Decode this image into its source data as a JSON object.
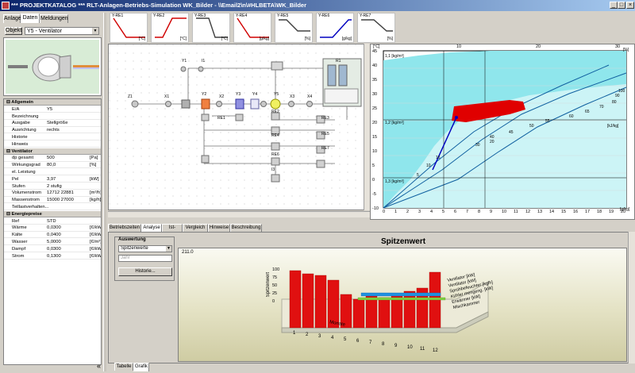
{
  "window": {
    "title": "*** PROJEKTKATALOG *** RLT-Anlagen-Betriebs-Simulation WK_Bilder - \\\\Email2\\n\\#HLBETA\\WK_Bilder"
  },
  "left_tabs": [
    "Anlage",
    "Daten",
    "Meldungen"
  ],
  "objekt_button": "Objekt",
  "objekt_select": "Y5 - Ventilator",
  "mini_charts": [
    {
      "label": "Y-RE1",
      "unit": "[°C]"
    },
    {
      "label": "Y-RE2",
      "unit": "[°C]"
    },
    {
      "label": "Y-RE3",
      "unit": "[°C]"
    },
    {
      "label": "Y-RE4",
      "unit": "[g/kg]"
    },
    {
      "label": "Y-RE5",
      "unit": "[%]"
    },
    {
      "label": "Y-RE6",
      "unit": "[g/kg]"
    },
    {
      "label": "Y-RE7",
      "unit": "[%]"
    }
  ],
  "properties": [
    {
      "section": "Allgemein"
    },
    {
      "k": "E/A",
      "v": "Y5",
      "u": ""
    },
    {
      "k": "Bezeichnung",
      "v": "",
      "u": ""
    },
    {
      "k": "Ausgabe",
      "v": "Stellgröße",
      "u": ""
    },
    {
      "k": "Ausrichtung",
      "v": "rechts",
      "u": ""
    },
    {
      "k": "Historie",
      "v": "",
      "u": ""
    },
    {
      "k": "Hinweis",
      "v": "",
      "u": ""
    },
    {
      "section": "Ventilator"
    },
    {
      "k": "dp gesamt",
      "v": "500",
      "u": "[Pa]"
    },
    {
      "k": "Wirkungsgrad",
      "v": "80,0",
      "u": "[%]"
    },
    {
      "k": "el. Leistung",
      "v": "",
      "u": ""
    },
    {
      "k": "Pel",
      "v": "3,97",
      "u": "[kW]"
    },
    {
      "k": "Stufen",
      "v": "2 stufig",
      "u": ""
    },
    {
      "k": "Volumenstrom",
      "v": "12712    22881",
      "u": "[m³/h]"
    },
    {
      "k": "Massenstrom",
      "v": "15000    27000",
      "u": "[kg/h]"
    },
    {
      "k": "Teillastverhalten...",
      "v": "",
      "u": ""
    },
    {
      "section": "Energiepreise"
    },
    {
      "k": "Ref",
      "v": "STD",
      "u": ""
    },
    {
      "k": "Wärme",
      "v": "0,0300",
      "u": "[€/kWh]"
    },
    {
      "k": "Kälte",
      "v": "0,0400",
      "u": "[€/kWh]"
    },
    {
      "k": "Wasser",
      "v": "5,0000",
      "u": "[€/m³]"
    },
    {
      "k": "Dampf",
      "v": "0,0300",
      "u": "[€/kWh]"
    },
    {
      "k": "Strom",
      "v": "0,1300",
      "u": "[€/kWh]"
    }
  ],
  "diagram_labels": [
    "Z1",
    "X1",
    "Y1",
    "I1",
    "Y2",
    "X2",
    "Y3",
    "Y4",
    "Y5",
    "X3",
    "X4",
    "R1",
    "I3",
    "RE1",
    "RE2",
    "RE3",
    "RE4",
    "RE5",
    "RE6",
    "RE7"
  ],
  "bottom_tabs": [
    "Betriebszeiten",
    "Analyse",
    "Ist-Daten",
    "Vergleich",
    "Hinweise",
    "Beschreibung"
  ],
  "auswertung": {
    "title": "Auswertung",
    "select1": "Spitzenwerte",
    "select2": "Jahr",
    "button": "Historie..."
  },
  "chart3d": {
    "title": "Spitzenwert",
    "ylabel": "Spitzenwert",
    "xlabel": "Monate",
    "topval": "211.0",
    "yticks": [
      "100",
      "75",
      "50",
      "25",
      "0"
    ],
    "months": [
      "1",
      "2",
      "3",
      "4",
      "5",
      "6",
      "7",
      "8",
      "9",
      "10",
      "11",
      "12"
    ],
    "series": [
      "Ventilator [kW]",
      "Ventilator [kW]",
      "Sprühbefeuchter [kg/h]",
      "Kühler mengeng. [kW]",
      "Erwärmer [kW]",
      "Mischkammer"
    ]
  },
  "footer_tabs": [
    "Tabelle",
    "Grafik"
  ],
  "chart_data": {
    "type": "psychrometric",
    "x_ticks": [
      "0",
      "1",
      "2",
      "3",
      "4",
      "5",
      "6",
      "7",
      "8",
      "9",
      "10",
      "11",
      "12",
      "13",
      "14",
      "15",
      "16",
      "17",
      "18",
      "19",
      "20"
    ],
    "y_ticks": [
      "45",
      "40",
      "35",
      "30",
      "25",
      "20",
      "15",
      "10",
      "5",
      "0",
      "-5",
      "-10"
    ],
    "top_ticks": [
      "10",
      "20",
      "30"
    ],
    "x_unit": "[g/kg]",
    "y_unit": "[°C]",
    "top_unit": "[%]",
    "labels": [
      "1,1 [kg/m³]",
      "1,2 [kg/m³]",
      "1,3 [kg/m³]",
      "[kJ/kg]",
      "20",
      "30",
      "40",
      "45",
      "50",
      "55",
      "60",
      "65",
      "70",
      "80",
      "90",
      "100",
      "10",
      "15",
      "5"
    ]
  }
}
